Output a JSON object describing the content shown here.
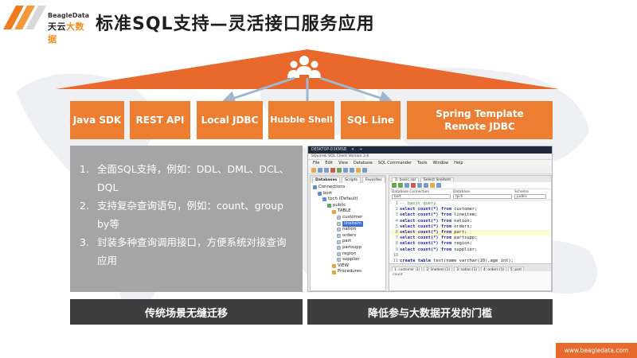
{
  "brand": {
    "name_en": "BeagleData",
    "name_cn_part1": "天云",
    "name_cn_part2": "大数据"
  },
  "title": "标准SQL支持—灵活接口服务应用",
  "interfaces": [
    {
      "label": "Java SDK"
    },
    {
      "label": "REST API"
    },
    {
      "label": "Local JDBC"
    },
    {
      "label": "Hubble Shell"
    },
    {
      "label": "SQL Line"
    },
    {
      "label": "Spring Template\nRemote JDBC"
    }
  ],
  "features": [
    {
      "num": "1.",
      "text": "全面SQL支持，例如：DDL、DML、DCL、DQL"
    },
    {
      "num": "2.",
      "text": "支持复杂查询语句，例如：count、group by等"
    },
    {
      "num": "3.",
      "text": "封装多种查询调用接口，方便系统对接查询应用"
    }
  ],
  "bars": {
    "left": "传统场景无缝迁移",
    "right": "降低参与大数据开发的门槛"
  },
  "screenshot": {
    "window_title": "DESKTOP-D3KMSB",
    "app_title": "SQuirreL SQL Client Version 3.6",
    "menus": [
      "File",
      "Edit",
      "View",
      "Database",
      "SQL Commander",
      "Tools",
      "Window",
      "Help"
    ],
    "nav_tabs": [
      "Databases",
      "Scripts",
      "Favorites"
    ],
    "tree": [
      {
        "label": "Connections",
        "level": 0,
        "icon": "db"
      },
      {
        "label": "bort",
        "level": 1,
        "icon": "db"
      },
      {
        "label": "tpch (Default)",
        "level": 2,
        "icon": "db"
      },
      {
        "label": "public",
        "level": 3,
        "icon": "schema"
      },
      {
        "label": "TABLE",
        "level": 4,
        "icon": "folder"
      },
      {
        "label": "customer",
        "level": 5,
        "icon": "table"
      },
      {
        "label": "lineitem",
        "level": 5,
        "icon": "table",
        "selected": true
      },
      {
        "label": "nation",
        "level": 5,
        "icon": "table"
      },
      {
        "label": "orders",
        "level": 5,
        "icon": "table"
      },
      {
        "label": "part",
        "level": 5,
        "icon": "table"
      },
      {
        "label": "partsupp",
        "level": 5,
        "icon": "table"
      },
      {
        "label": "region",
        "level": 5,
        "icon": "table"
      },
      {
        "label": "supplier",
        "level": 5,
        "icon": "table"
      },
      {
        "label": "VIEW",
        "level": 4,
        "icon": "folder"
      },
      {
        "label": "Procedures",
        "level": 4,
        "icon": "folder"
      }
    ],
    "editor_tabs": [
      "1: basic.sql",
      "Select lineitem"
    ],
    "conn_labels": [
      "Database Connection",
      "Database",
      "Schema"
    ],
    "conn_values": [
      "bort",
      "tpch",
      "public"
    ],
    "code": [
      {
        "n": "1",
        "kw": "",
        "rest": "-- basic query",
        "comment": true
      },
      {
        "n": "2",
        "kw": "select count(*) from",
        "rest": " customer;"
      },
      {
        "n": "3",
        "kw": "select count(*) from",
        "rest": " lineitem;"
      },
      {
        "n": "4",
        "kw": "select count(*) from",
        "rest": " nation;"
      },
      {
        "n": "5",
        "kw": "select count(*) from",
        "rest": " orders;"
      },
      {
        "n": "6",
        "kw": "select count(*) from",
        "rest": " part;",
        "highlight": true
      },
      {
        "n": "7",
        "kw": "select count(*) from",
        "rest": " partsupp;"
      },
      {
        "n": "8",
        "kw": "select count(*) from",
        "rest": " region;"
      },
      {
        "n": "9",
        "kw": "select count(*) from",
        "rest": " supplier;"
      },
      {
        "n": "10",
        "kw": "",
        "rest": ""
      },
      {
        "n": "11",
        "kw": "create table",
        "rest": " test(name varchar(10),age int);"
      },
      {
        "n": "12",
        "kw": "",
        "rest": "show tables test;"
      }
    ],
    "result_tabs": [
      "1: customer (1)",
      "2: lineitem (1)",
      "3: nation (1)",
      "4: orders (1)",
      "5: part"
    ],
    "result_header": "count"
  },
  "url": "www.beagledata.com",
  "colors": {
    "accent": "#ED7D31",
    "roof": "#E8692B",
    "panel_gray": "#A5A5A5",
    "bar_dark": "#3E3E3E"
  }
}
